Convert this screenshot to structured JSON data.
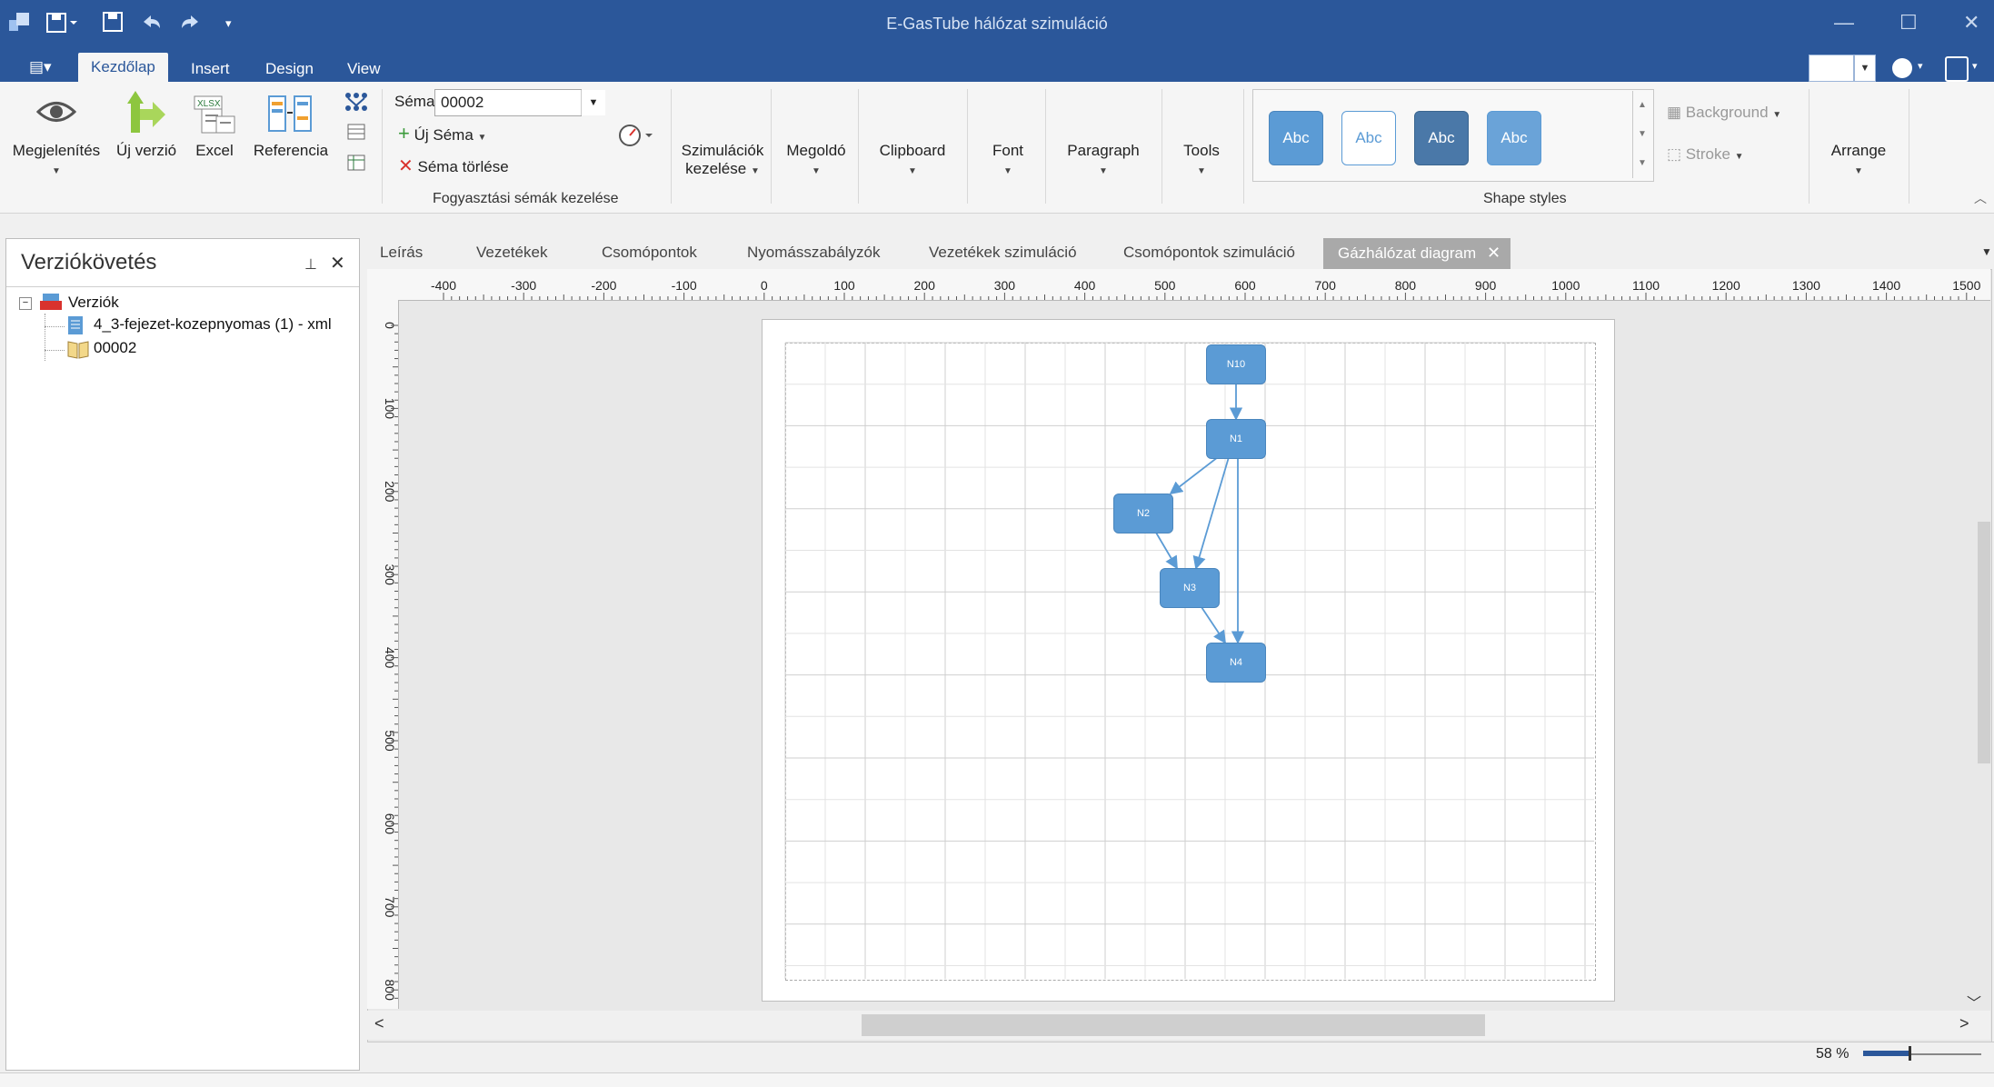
{
  "window": {
    "title": "E-GasTube hálózat szimuláció"
  },
  "ribbon_tabs": [
    "Kezdőlap",
    "Insert",
    "Design",
    "View"
  ],
  "ribbon": {
    "megjelenites": "Megjelenítés",
    "uj_verzio": "Új verzió",
    "excel": "Excel",
    "referencia": "Referencia",
    "sema_label": "Séma",
    "sema_value": "00002",
    "uj_sema": "Új Séma",
    "sema_torlese": "Séma törlése",
    "group_fogyasztasi": "Fogyasztási sémák kezelése",
    "szimulaciok_1": "Szimulációk",
    "szimulaciok_2": "kezelése",
    "megoldo": "Megoldó",
    "clipboard": "Clipboard",
    "font": "Font",
    "paragraph": "Paragraph",
    "tools": "Tools",
    "shape_styles": [
      "Abc",
      "Abc",
      "Abc",
      "Abc"
    ],
    "shape_styles_label": "Shape styles",
    "background": "Background",
    "stroke": "Stroke",
    "arrange": "Arrange"
  },
  "left_panel": {
    "title": "Verziókövetés",
    "tree": {
      "root": "Verziók",
      "items": [
        "4_3-fejezet-kozepnyomas (1) - xml",
        "00002"
      ]
    }
  },
  "doc_tabs": [
    "Leírás",
    "Vezetékek",
    "Csomópontok",
    "Nyomásszabályzók",
    "Vezetékek szimuláció",
    "Csomópontok szimuláció",
    "Gázhálózat diagram"
  ],
  "ruler": {
    "x": [
      "-400",
      "-300",
      "-200",
      "-100",
      "0",
      "100",
      "200",
      "300",
      "400",
      "500",
      "600",
      "700",
      "800",
      "900",
      "1000",
      "1100",
      "1200",
      "1300",
      "1400",
      "1500"
    ],
    "y": [
      "0",
      "100",
      "200",
      "300",
      "400",
      "500",
      "600",
      "700",
      "800"
    ]
  },
  "diagram": {
    "nodes": [
      "N10",
      "N1",
      "N2",
      "N3",
      "N4"
    ]
  },
  "status": {
    "zoom": "58 %"
  },
  "colors": {
    "titlebar": "#2b579a",
    "node_fill": "#5b9bd5",
    "edge": "#5b9bd5"
  }
}
